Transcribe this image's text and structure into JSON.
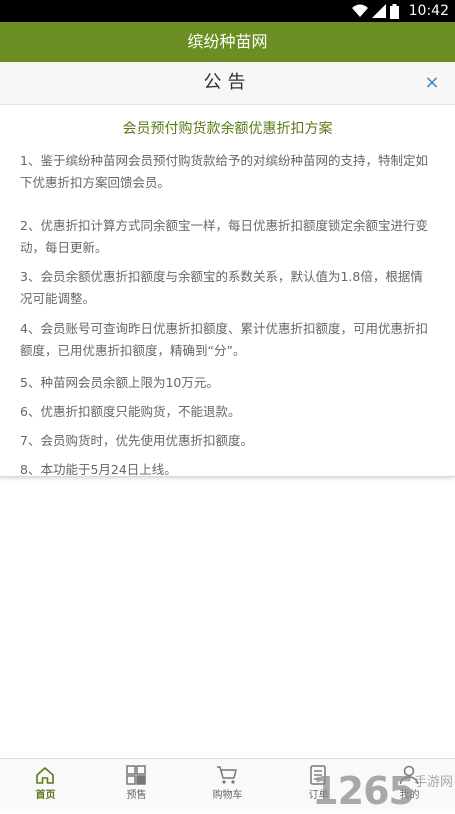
{
  "status_bar": {
    "time": "10:42",
    "icons": [
      "wifi-icon",
      "signal-icon",
      "battery-icon"
    ]
  },
  "header": {
    "title": "缤纷种苗网"
  },
  "notice": {
    "title": "公告",
    "close_label": "×",
    "subtitle": "会员预付购货款余额优惠折扣方案",
    "items": [
      "1、鉴于缤纷种苗网会员预付购货款给予的对缤纷种苗网的支持，特制定如下优惠折扣方案回馈会员。",
      "2、优惠折扣计算方式同余额宝一样，每日优惠折扣额度锁定余额宝进行变动，每日更新。",
      "3、会员余额优惠折扣额度与余额宝的系数关系，默认值为1.8倍，根据情况可能调整。",
      "4、会员账号可查询昨日优惠折扣额度、累计优惠折扣额度，可用优惠折扣额度，已用优惠折扣额度，精确到“分”。",
      "5、种苗网会员余额上限为10万元。",
      "6、优惠折扣额度只能购货，不能退款。",
      "7、会员购货时，优先使用优惠折扣额度。",
      "8、本功能于5月24日上线。"
    ]
  },
  "tabs": [
    {
      "label": "首页",
      "icon": "home-icon",
      "active": true
    },
    {
      "label": "预售",
      "icon": "grid-icon",
      "active": false
    },
    {
      "label": "购物车",
      "icon": "cart-icon",
      "active": false
    },
    {
      "label": "订单",
      "icon": "order-icon",
      "active": false
    },
    {
      "label": "我的",
      "icon": "user-icon",
      "active": false
    }
  ],
  "watermark": {
    "number": "265",
    "prefix": "1",
    "suffix": "手游网"
  },
  "colors": {
    "header_bg": "#6b8e23",
    "accent_green": "#5a7a1a",
    "close_blue": "#3a86c8"
  }
}
